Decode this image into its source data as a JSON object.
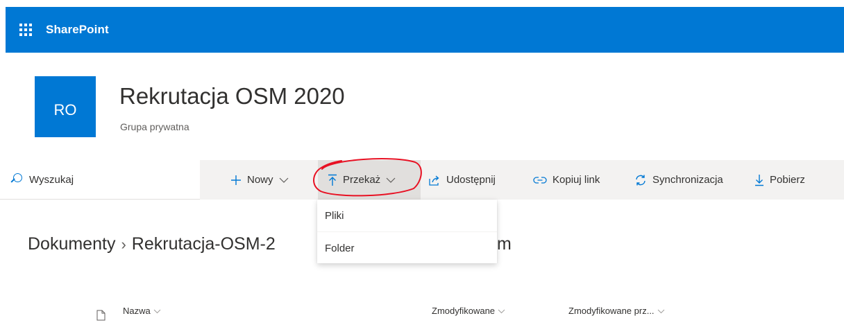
{
  "header": {
    "app_name": "SharePoint",
    "waffle_icon": "app-launcher-icon"
  },
  "site": {
    "logo_initials": "RO",
    "title": "Rekrutacja OSM 2020",
    "subtitle": "Grupa prywatna"
  },
  "commandbar": {
    "search_placeholder": "Wyszukaj",
    "new_label": "Nowy",
    "upload_label": "Przekaż",
    "share_label": "Udostępnij",
    "copy_link_label": "Kopiuj link",
    "sync_label": "Synchronizacja",
    "download_label": "Pobierz"
  },
  "upload_menu": {
    "items": [
      {
        "label": "Pliki"
      },
      {
        "label": "Folder"
      }
    ]
  },
  "breadcrumb": {
    "root": "Dokumenty",
    "folder_visible": "Rekrutacja-OSM-2",
    "folder_tail_visible": "m"
  },
  "list": {
    "columns": [
      {
        "label": "Nazwa"
      },
      {
        "label": "Zmodyfikowane"
      },
      {
        "label": "Zmodyfikowane prz..."
      }
    ]
  },
  "colors": {
    "brand": "#0078d4",
    "annotation": "#e81123",
    "commandbar_bg": "#f3f2f1"
  }
}
